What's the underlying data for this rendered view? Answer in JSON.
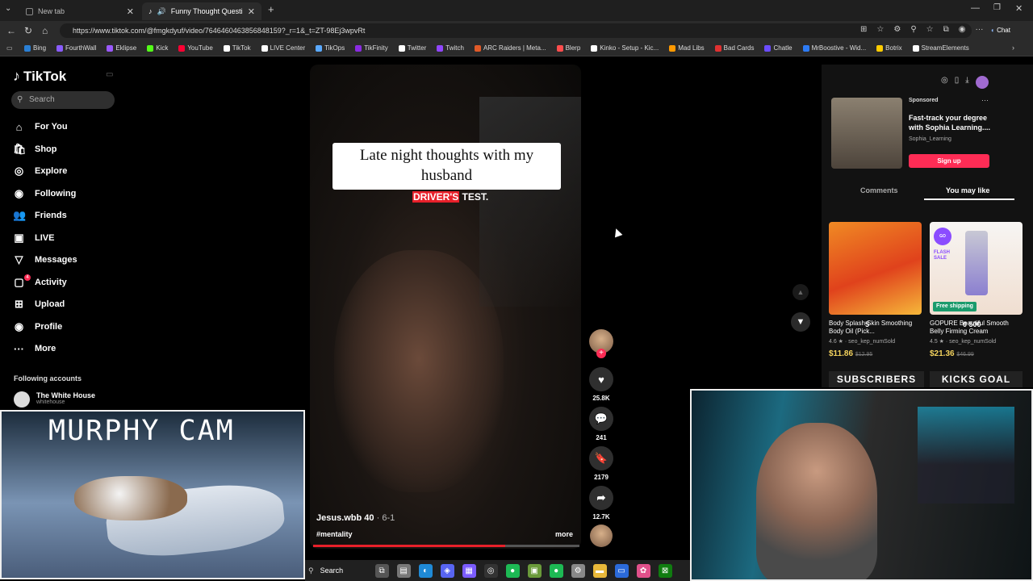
{
  "browser": {
    "tabs": [
      {
        "label": "New tab",
        "active": false
      },
      {
        "label": "Funny Thought Questions: All",
        "active": true
      }
    ],
    "url": "https://www.tiktok.com/@fmgkdyuf/video/7646460463856848159?_r=1&_t=ZT-98Ej3wpvRt",
    "bookmarks": [
      "Bing",
      "FourthWall",
      "Eklipse",
      "Kick",
      "YouTube",
      "TikTok",
      "LIVE Center",
      "TikOps",
      "TikFinity",
      "Twitter",
      "Twitch",
      "ARC Raiders | Meta...",
      "Blerp",
      "Kinko - Setup - Kic...",
      "Mad Libs",
      "Bad Cards",
      "Chatle",
      "MrBoostive - Wid...",
      "Botrix",
      "StreamElements"
    ],
    "bookmark_colors": [
      "#2a7fd4",
      "#8a5cff",
      "#9b59ff",
      "#53fc18",
      "#ff0033",
      "#ffffff",
      "#ffffff",
      "#5aa9ff",
      "#8a2be2",
      "#ffffff",
      "#9146ff",
      "#e05a28",
      "#ff4d4d",
      "#ffffff",
      "#ff9900",
      "#e03131",
      "#6b4cff",
      "#2d7bf4",
      "#ffcc00",
      "#ffffff"
    ],
    "chat_label": "Chat"
  },
  "tiktok": {
    "logo": "TikTok",
    "search_placeholder": "Search",
    "nav": [
      {
        "label": "For You",
        "icon": "home-icon",
        "glyph": "⌂"
      },
      {
        "label": "Shop",
        "icon": "shop-icon",
        "glyph": "🛍"
      },
      {
        "label": "Explore",
        "icon": "compass-icon",
        "glyph": "◎"
      },
      {
        "label": "Following",
        "icon": "following-avatar-icon",
        "glyph": "◉"
      },
      {
        "label": "Friends",
        "icon": "friends-icon",
        "glyph": "👥"
      },
      {
        "label": "LIVE",
        "icon": "live-icon",
        "glyph": "▣"
      },
      {
        "label": "Messages",
        "icon": "messages-icon",
        "glyph": "▽"
      },
      {
        "label": "Activity",
        "icon": "activity-icon",
        "glyph": "▢"
      },
      {
        "label": "Upload",
        "icon": "upload-icon",
        "glyph": "⊞"
      },
      {
        "label": "Profile",
        "icon": "profile-icon",
        "glyph": "◉"
      },
      {
        "label": "More",
        "icon": "more-icon",
        "glyph": "···"
      }
    ],
    "activity_badge": "4",
    "following_accounts_title": "Following accounts",
    "following_account": {
      "name": "The White House",
      "handle": "whitehouse"
    },
    "video": {
      "caption": "Late night thoughts with my husband",
      "subtitle_highlight": "DRIVER'S",
      "subtitle_rest": " TEST.",
      "author": "Jesus.wbb 40",
      "date": "6-1",
      "hashtag": "#mentality",
      "more": "more",
      "progress": 0.72
    },
    "actions": {
      "likes": "25.8K",
      "comments": "241",
      "saves": "2179",
      "shares": "12.7K"
    },
    "ad": {
      "sponsored": "Sponsored",
      "title": "Fast-track your degree with Sophia Learning....",
      "handle": "Sophia_Learning",
      "cta": "Sign up"
    },
    "right_tabs": {
      "comments": "Comments",
      "you_may_like": "You may like"
    },
    "products": [
      {
        "name": "Body Splash Skin Smoothing Body Oil (Pick...",
        "rating": "4.6 ★ · seo_kep_numSold",
        "price": "$11.86",
        "old_price": "$12.95",
        "badge": ""
      },
      {
        "name": "GOPURE Beautiful Smooth Belly Firming Cream",
        "rating": "4.5 ★ · seo_kep_numSold",
        "price": "$21.36",
        "old_price": "$46.99",
        "badge": "Free shipping"
      }
    ],
    "product_overlay_a": "5",
    "product_overlay_b": "0 500",
    "flash_sale": "FLASH SALE"
  },
  "overlays": {
    "murphy_cam": "MURPHY CAM",
    "subscribers_goal": "SUBSCRIBERS",
    "kicks_goal": "KICKS GOAL"
  },
  "taskbar": {
    "search": "Search",
    "apps": [
      "search-app-icon",
      "file-explorer-icon",
      "edge-icon",
      "discord-icon",
      "app-grid-icon",
      "obs-icon",
      "spotify-icon",
      "minecraft-icon",
      "spotify-green-icon",
      "settings-icon",
      "folder-icon",
      "notepad-icon",
      "photos-icon",
      "xbox-icon"
    ]
  }
}
